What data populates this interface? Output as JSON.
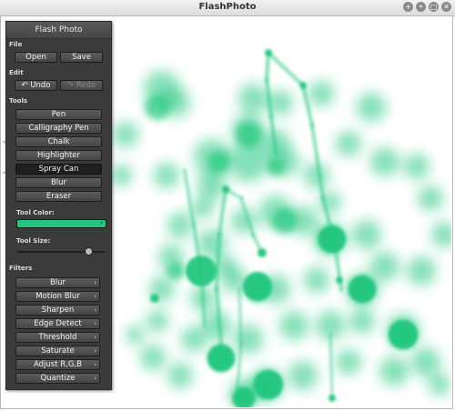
{
  "window": {
    "title": "FlashPhoto"
  },
  "window_buttons": [
    "+",
    "•",
    "□",
    "✕"
  ],
  "panel": {
    "title": "Flash Photo",
    "file": {
      "label": "File",
      "open": "Open",
      "save": "Save"
    },
    "edit": {
      "label": "Edit",
      "undo": "Undo",
      "redo": "Redo"
    },
    "tools": {
      "label": "Tools",
      "items": [
        "Pen",
        "Calligraphy Pen",
        "Chalk",
        "Highlighter",
        "Spray Can",
        "Blur",
        "Eraser"
      ],
      "selected": "Spray Can"
    },
    "tool_color": {
      "label": "Tool Color:",
      "value": "#21c77e"
    },
    "tool_size": {
      "label": "Tool Size:",
      "value": 0.8
    },
    "filters": {
      "label": "Filters",
      "items": [
        "Blur",
        "Motion Blur",
        "Sharpen",
        "Edge Detect",
        "Threshold",
        "Saturate",
        "Adjust R,G,B",
        "Quantize"
      ]
    }
  },
  "colors": {
    "paint": "#21c77e",
    "panel_bg": "#3b3b3b"
  }
}
